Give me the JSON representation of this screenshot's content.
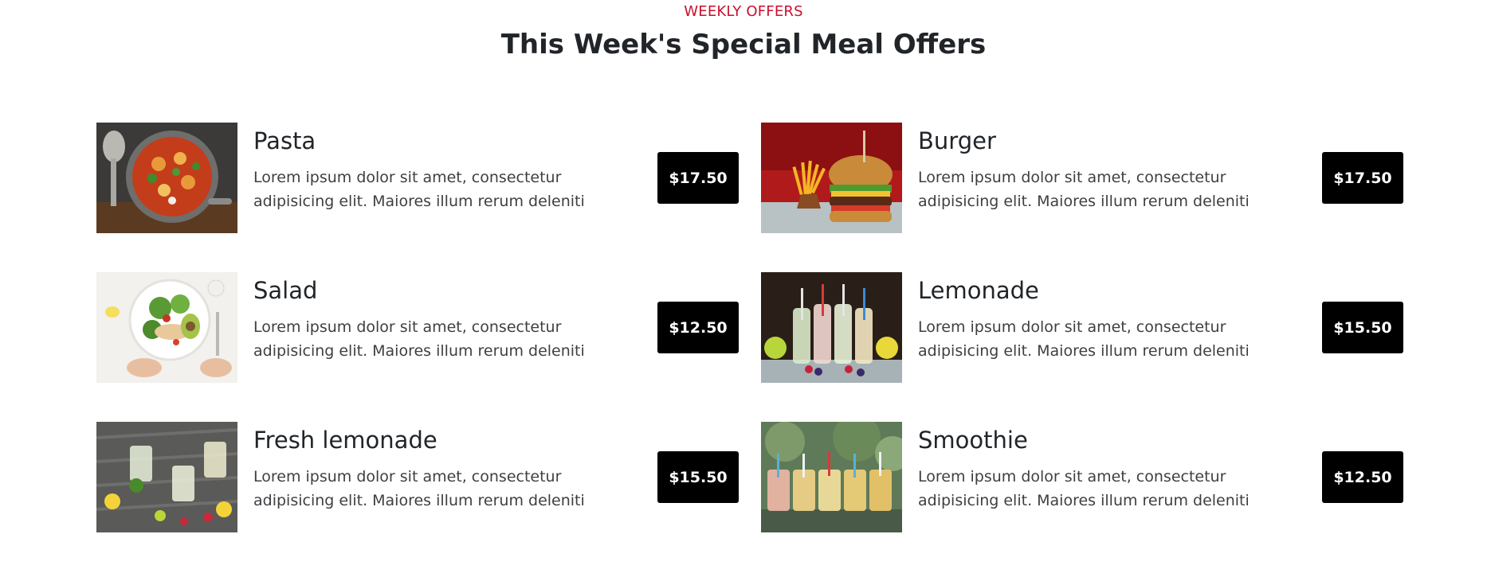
{
  "section": {
    "eyebrow": "WEEKLY OFFERS",
    "title": "This Week's Special Meal Offers"
  },
  "colors": {
    "accent": "#c8102e",
    "price_bg": "#000000",
    "price_text": "#ffffff"
  },
  "offers": [
    {
      "name": "Pasta",
      "description": "Lorem ipsum dolor sit amet, consectetur adipisicing elit. Maiores illum rerum deleniti",
      "price": "$17.50",
      "image_icon": "pasta-dish-photo"
    },
    {
      "name": "Burger",
      "description": "Lorem ipsum dolor sit amet, consectetur adipisicing elit. Maiores illum rerum deleniti",
      "price": "$17.50",
      "image_icon": "burger-fries-photo"
    },
    {
      "name": "Salad",
      "description": "Lorem ipsum dolor sit amet, consectetur adipisicing elit. Maiores illum rerum deleniti",
      "price": "$12.50",
      "image_icon": "salad-bowl-photo"
    },
    {
      "name": "Lemonade",
      "description": "Lorem ipsum dolor sit amet, consectetur adipisicing elit. Maiores illum rerum deleniti",
      "price": "$15.50",
      "image_icon": "lemonade-bottles-photo"
    },
    {
      "name": "Fresh lemonade",
      "description": "Lorem ipsum dolor sit amet, consectetur adipisicing elit. Maiores illum rerum deleniti",
      "price": "$15.50",
      "image_icon": "fresh-lemonade-glasses-photo"
    },
    {
      "name": "Smoothie",
      "description": "Lorem ipsum dolor sit amet, consectetur adipisicing elit. Maiores illum rerum deleniti",
      "price": "$12.50",
      "image_icon": "smoothie-jars-photo"
    }
  ]
}
